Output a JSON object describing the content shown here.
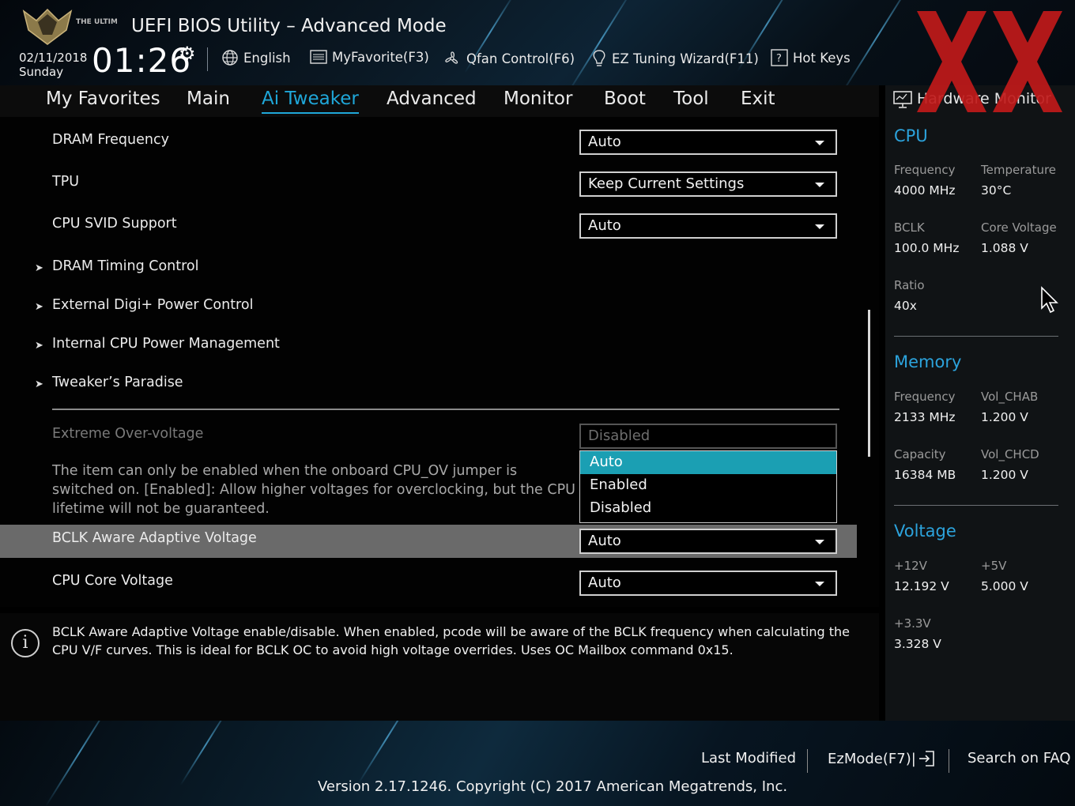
{
  "header": {
    "title": "UEFI BIOS Utility – Advanced Mode",
    "logo_text": "THE ULTIMATE FORCE",
    "date": "02/11/2018",
    "day": "Sunday",
    "time": "01:26",
    "items": {
      "language": "English",
      "my_favorite": "MyFavorite(F3)",
      "qfan": "Qfan Control(F6)",
      "ez_tuning": "EZ Tuning Wizard(F11)",
      "hot_keys": "Hot Keys"
    }
  },
  "tabs": [
    "My Favorites",
    "Main",
    "Ai Tweaker",
    "Advanced",
    "Monitor",
    "Boot",
    "Tool",
    "Exit"
  ],
  "active_tab": "Ai Tweaker",
  "settings": {
    "dram_frequency": {
      "label": "DRAM Frequency",
      "value": "Auto"
    },
    "tpu": {
      "label": "TPU",
      "value": "Keep Current Settings"
    },
    "cpu_svid": {
      "label": "CPU SVID Support",
      "value": "Auto"
    },
    "submenus": [
      "DRAM Timing Control",
      "External Digi+ Power Control",
      "Internal CPU Power Management",
      "Tweaker’s Paradise"
    ],
    "extreme_ov": {
      "label": "Extreme Over-voltage",
      "value": "Disabled"
    },
    "note": "The item can only be enabled when the onboard CPU_OV jumper is switched on. [Enabled]: Allow higher voltages for overclocking, but the CPU lifetime will not be guaranteed.",
    "bclk_aware": {
      "label": "BCLK Aware Adaptive Voltage",
      "value": "Auto"
    },
    "cpu_core_voltage": {
      "label": "CPU Core Voltage",
      "value": "Auto"
    }
  },
  "dropdown_options": [
    "Auto",
    "Enabled",
    "Disabled"
  ],
  "dropdown_selected": "Auto",
  "help_text": "BCLK Aware Adaptive Voltage enable/disable. When enabled, pcode will be aware of the BCLK frequency when calculating the CPU V/F curves. This is ideal for BCLK OC to avoid high voltage overrides. Uses OC Mailbox command 0x15.",
  "hw_monitor": {
    "title": "Hardware Monitor",
    "cpu": {
      "heading": "CPU",
      "frequency_label": "Frequency",
      "frequency": "4000 MHz",
      "temperature_label": "Temperature",
      "temperature": "30°C",
      "bclk_label": "BCLK",
      "bclk": "100.0 MHz",
      "core_voltage_label": "Core Voltage",
      "core_voltage": "1.088 V",
      "ratio_label": "Ratio",
      "ratio": "40x"
    },
    "memory": {
      "heading": "Memory",
      "frequency_label": "Frequency",
      "frequency": "2133 MHz",
      "vol_chab_label": "Vol_CHAB",
      "vol_chab": "1.200 V",
      "capacity_label": "Capacity",
      "capacity": "16384 MB",
      "vol_chcd_label": "Vol_CHCD",
      "vol_chcd": "1.200 V"
    },
    "voltage": {
      "heading": "Voltage",
      "v12_label": "+12V",
      "v12": "12.192 V",
      "v5_label": "+5V",
      "v5": "5.000 V",
      "v33_label": "+3.3V",
      "v33": "3.328 V"
    }
  },
  "footer": {
    "last_modified": "Last Modified",
    "ezmode": "EzMode(F7)|",
    "search_faq": "Search on FAQ",
    "version": "Version 2.17.1246. Copyright (C) 2017 American Megatrends, Inc."
  },
  "colors": {
    "accent": "#1fa7d9",
    "selected_option": "#1b9fb3",
    "highlight_row": "#6a6a6a",
    "watermark": "#c01a1a"
  }
}
